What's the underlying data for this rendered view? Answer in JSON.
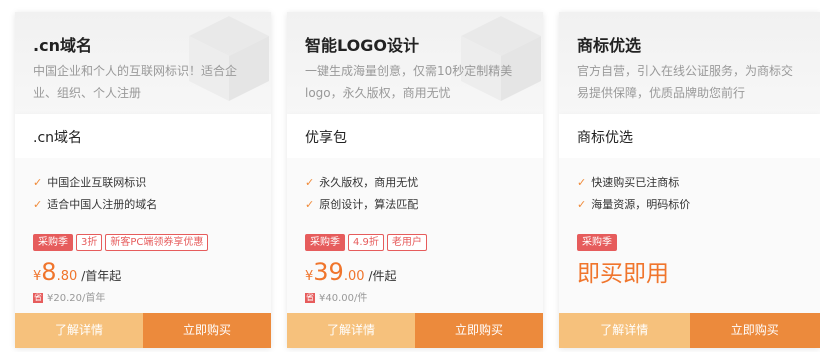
{
  "cards": [
    {
      "title": ".cn域名",
      "desc": "中国企业和个人的互联网标识！适合企业、组织、个人注册",
      "subtitle": ".cn域名",
      "features": [
        "中国企业互联网标识",
        "适合中国人注册的域名"
      ],
      "tags": [
        "采购季",
        "3折",
        "新客PC端领券享优惠"
      ],
      "price": {
        "currency": "¥",
        "integer": "8",
        "decimal": ".80",
        "unit": "/首年起"
      },
      "original": {
        "badge": "省",
        "text": "¥20.20/首年"
      },
      "buttons": {
        "detail": "了解详情",
        "buy": "立即购买"
      }
    },
    {
      "title": "智能LOGO设计",
      "desc": "一键生成海量创意，仅需10秒定制精美logo，永久版权，商用无忧",
      "subtitle": "优享包",
      "features": [
        "永久版权，商用无忧",
        "原创设计，算法匹配"
      ],
      "tags": [
        "采购季",
        "4.9折",
        "老用户"
      ],
      "price": {
        "currency": "¥",
        "integer": "39",
        "decimal": ".00",
        "unit": "/件起"
      },
      "original": {
        "badge": "省",
        "text": "¥40.00/件"
      },
      "buttons": {
        "detail": "了解详情",
        "buy": "立即购买"
      }
    },
    {
      "title": "商标优选",
      "desc": "官方自营，引入在线公证服务，为商标交易提供保障，优质品牌助您前行",
      "subtitle": "商标优选",
      "features": [
        "快速购买已注商标",
        "海量资源，明码标价"
      ],
      "tags": [
        "采购季"
      ],
      "headline": "即买即用",
      "buttons": {
        "detail": "了解详情",
        "buy": "立即购买"
      }
    }
  ],
  "colors": {
    "accent": "#f0752c",
    "tag_red": "#e65c5c",
    "detail_button": "#f6c17c",
    "buy_button": "#ec8a3c"
  }
}
